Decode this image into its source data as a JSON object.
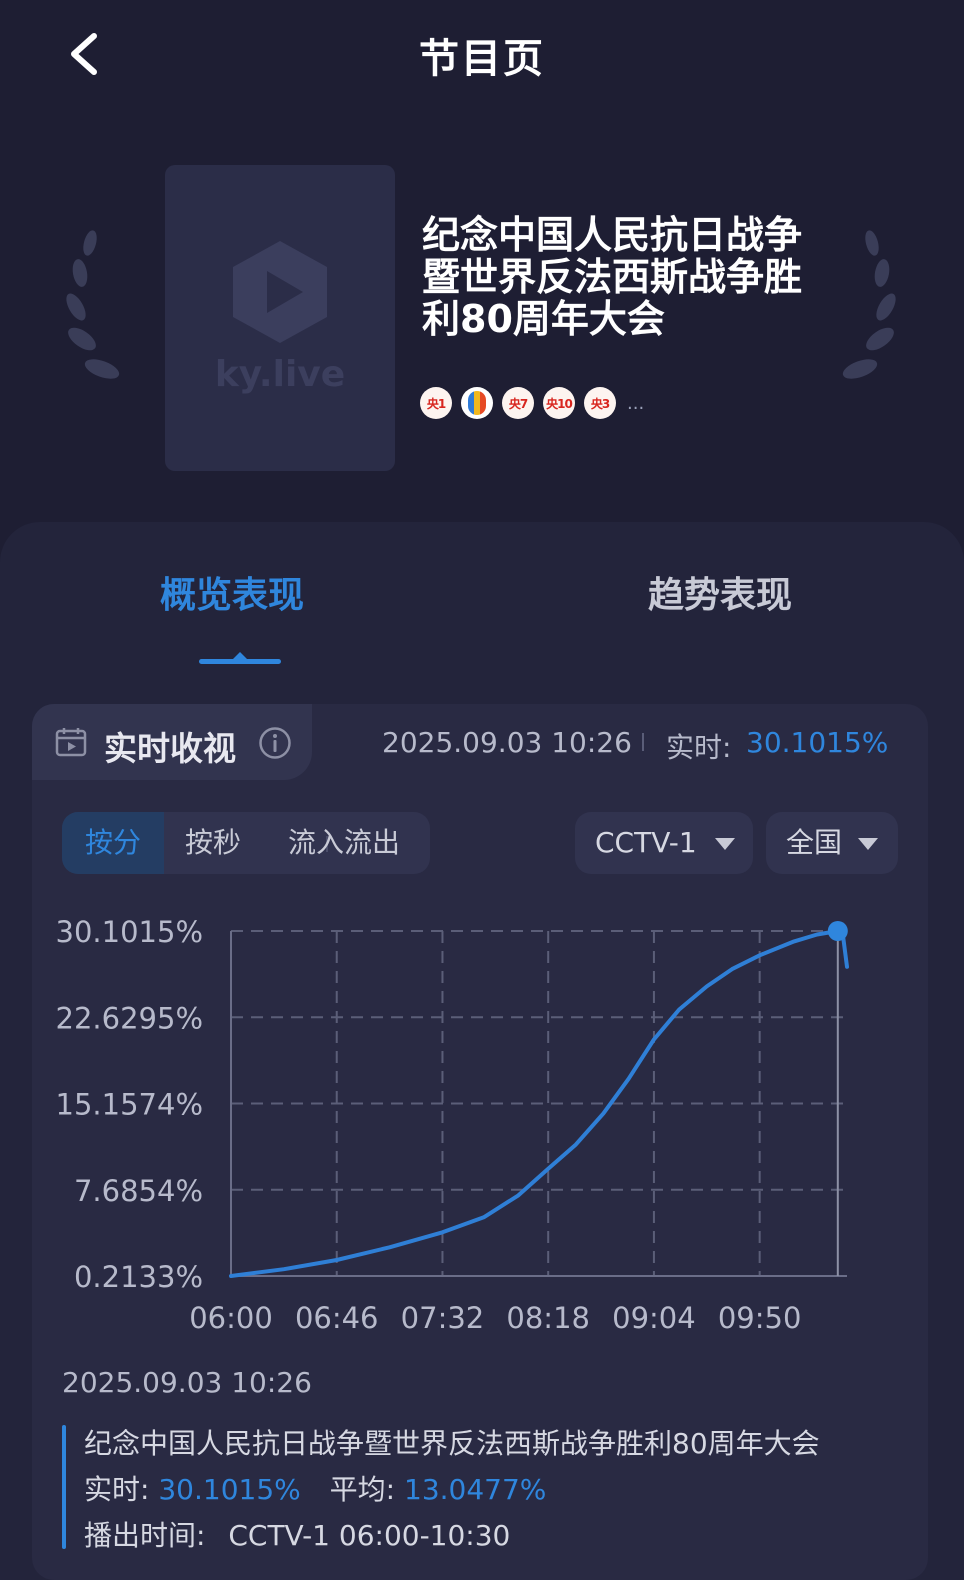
{
  "header": {
    "title": "节目页"
  },
  "program": {
    "poster_logo_text": "ky.live",
    "title": "纪念中国人民抗日战争暨世界反法西斯战争胜利80周年大会",
    "channels": [
      {
        "label": "央1"
      },
      {
        "label": "CGTN"
      },
      {
        "label": "央7"
      },
      {
        "label": "央10"
      },
      {
        "label": "央3"
      }
    ],
    "more": "..."
  },
  "tabs": {
    "overview": "概览表现",
    "trend": "趋势表现"
  },
  "realtime": {
    "label": "实时收视",
    "timestamp": "2025.09.03 10:26",
    "live_label": "实时:",
    "live_value": "30.1015%"
  },
  "controls": {
    "segments": [
      "按分",
      "按秒",
      "流入流出"
    ],
    "channel_select": "CCTV-1",
    "region_select": "全国"
  },
  "chart_data": {
    "type": "line",
    "x_ticks": [
      "06:00",
      "06:46",
      "07:32",
      "08:18",
      "09:04",
      "09:50"
    ],
    "y_ticks": [
      "30.1015%",
      "22.6295%",
      "15.1574%",
      "7.6854%",
      "0.2133%"
    ],
    "ylim": [
      0.2133,
      30.1015
    ],
    "grid": true,
    "series": [
      {
        "color": "#2f7fd6",
        "points": [
          [
            "06:00",
            0.21
          ],
          [
            "06:23",
            0.8
          ],
          [
            "06:46",
            1.6
          ],
          [
            "07:09",
            2.7
          ],
          [
            "07:32",
            4.0
          ],
          [
            "07:50",
            5.3
          ],
          [
            "08:05",
            7.2
          ],
          [
            "08:18",
            9.5
          ],
          [
            "08:30",
            11.6
          ],
          [
            "08:42",
            14.3
          ],
          [
            "08:53",
            17.3
          ],
          [
            "09:04",
            20.7
          ],
          [
            "09:15",
            23.3
          ],
          [
            "09:27",
            25.3
          ],
          [
            "09:38",
            26.8
          ],
          [
            "09:50",
            28.0
          ],
          [
            "10:05",
            29.2
          ],
          [
            "10:15",
            29.8
          ],
          [
            "10:24",
            30.1
          ],
          [
            "10:26",
            30.1
          ],
          [
            "10:28",
            27.0
          ]
        ]
      }
    ],
    "highlight_point": [
      "10:24",
      30.1015
    ]
  },
  "summary": {
    "timestamp": "2025.09.03 10:26",
    "program_title": "纪念中国人民抗日战争暨世界反法西斯战争胜利80周年大会",
    "live_label": "实时:",
    "live_value": "30.1015%",
    "avg_label": "平均:",
    "avg_value": "13.0477%",
    "airtime_label": "播出时间:",
    "airtime_value": "CCTV-1 06:00-10:30"
  }
}
